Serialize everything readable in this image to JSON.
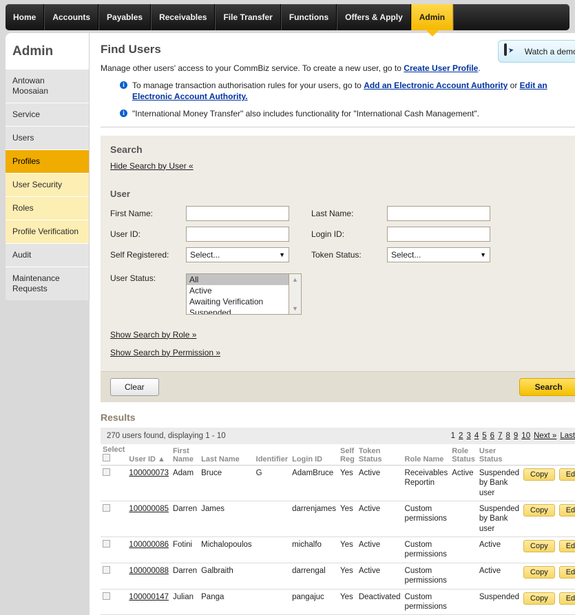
{
  "topnav": {
    "items": [
      {
        "label": "Home",
        "active": false
      },
      {
        "label": "Accounts",
        "active": false
      },
      {
        "label": "Payables",
        "active": false
      },
      {
        "label": "Receivables",
        "active": false
      },
      {
        "label": "File Transfer",
        "active": false
      },
      {
        "label": "Functions",
        "active": false
      },
      {
        "label": "Offers & Apply",
        "active": false
      },
      {
        "label": "Admin",
        "active": true
      }
    ],
    "accent_color": "#f5b800"
  },
  "sidebar": {
    "title": "Admin",
    "items": [
      {
        "label": "Antowan Moosaian",
        "style": "grey"
      },
      {
        "label": "Service",
        "style": "grey"
      },
      {
        "label": "Users",
        "style": "grey"
      },
      {
        "label": "Profiles",
        "style": "active"
      },
      {
        "label": "User Security",
        "style": "cream"
      },
      {
        "label": "Roles",
        "style": "cream"
      },
      {
        "label": "Profile Verification",
        "style": "cream"
      },
      {
        "label": "Audit",
        "style": "grey"
      },
      {
        "label": "Maintenance Requests",
        "style": "grey"
      }
    ]
  },
  "header": {
    "title": "Find Users",
    "demo_button": "Watch a demo",
    "intro_text_before": "Manage other users' access to your CommBiz service. To create a new user, go to ",
    "intro_link": "Create User Profile",
    "intro_text_after": ".",
    "notices": [
      {
        "before": "To manage transaction authorisation rules for your users, go to ",
        "link1": "Add an Electronic Account Authority",
        "mid": " or ",
        "link2": "Edit an Electronic Account Authority.",
        "after": ""
      },
      {
        "before": "\"International Money Transfer\" also includes functionality for \"International Cash Management\".",
        "link1": "",
        "mid": "",
        "link2": "",
        "after": ""
      }
    ]
  },
  "search": {
    "panel_title": "Search",
    "hide_link": "Hide Search by User «",
    "section_title": "User",
    "fields": {
      "first_name_label": "First Name:",
      "first_name_value": "",
      "last_name_label": "Last Name:",
      "last_name_value": "",
      "user_id_label": "User ID:",
      "user_id_value": "",
      "login_id_label": "Login ID:",
      "login_id_value": "",
      "self_registered_label": "Self Registered:",
      "self_registered_value": "Select...",
      "token_status_label": "Token Status:",
      "token_status_value": "Select...",
      "user_status_label": "User Status:"
    },
    "user_status_options": [
      "All",
      "Active",
      "Awaiting Verification",
      "Suspended"
    ],
    "user_status_selected": "All",
    "show_role_link": "Show Search by Role »",
    "show_permission_link": "Show Search by Permission »",
    "clear_button": "Clear",
    "search_button": "Search"
  },
  "results": {
    "title": "Results",
    "summary": "270 users found, displaying 1 - 10",
    "pagination": {
      "current": "1",
      "pages": [
        "2",
        "3",
        "4",
        "5",
        "6",
        "7",
        "8",
        "9",
        "10"
      ],
      "next": "Next »",
      "last": "Last »"
    },
    "columns": [
      "Select",
      "User ID ▲",
      "First Name",
      "Last Name",
      "Identifier",
      "Login ID",
      "Self Reg",
      "Token Status",
      "Role Name",
      "Role Status",
      "User Status"
    ],
    "copy_label": "Copy",
    "edit_label": "Edit",
    "rows": [
      {
        "user_id": "100000073",
        "first_name": "Adam",
        "last_name": "Bruce",
        "identifier": "G",
        "login_id": "AdamBruce",
        "self_reg": "Yes",
        "token_status": "Active",
        "role_name": "Receivables Reportin",
        "role_status": "Active",
        "user_status": "Suspended by Bank user"
      },
      {
        "user_id": "100000085",
        "first_name": "Darren",
        "last_name": "James",
        "identifier": "",
        "login_id": "darrenjames",
        "self_reg": "Yes",
        "token_status": "Active",
        "role_name": "Custom permissions",
        "role_status": "",
        "user_status": "Suspended by Bank user"
      },
      {
        "user_id": "100000086",
        "first_name": "Fotini",
        "last_name": "Michalopoulos",
        "identifier": "",
        "login_id": "michalfo",
        "self_reg": "Yes",
        "token_status": "Active",
        "role_name": "Custom permissions",
        "role_status": "",
        "user_status": "Active"
      },
      {
        "user_id": "100000088",
        "first_name": "Darren",
        "last_name": "Galbraith",
        "identifier": "",
        "login_id": "darrengal",
        "self_reg": "Yes",
        "token_status": "Active",
        "role_name": "Custom permissions",
        "role_status": "",
        "user_status": "Active"
      },
      {
        "user_id": "100000147",
        "first_name": "Julian",
        "last_name": "Panga",
        "identifier": "",
        "login_id": "pangajuc",
        "self_reg": "Yes",
        "token_status": "Deactivated",
        "role_name": "Custom permissions",
        "role_status": "",
        "user_status": "Suspended"
      }
    ]
  }
}
